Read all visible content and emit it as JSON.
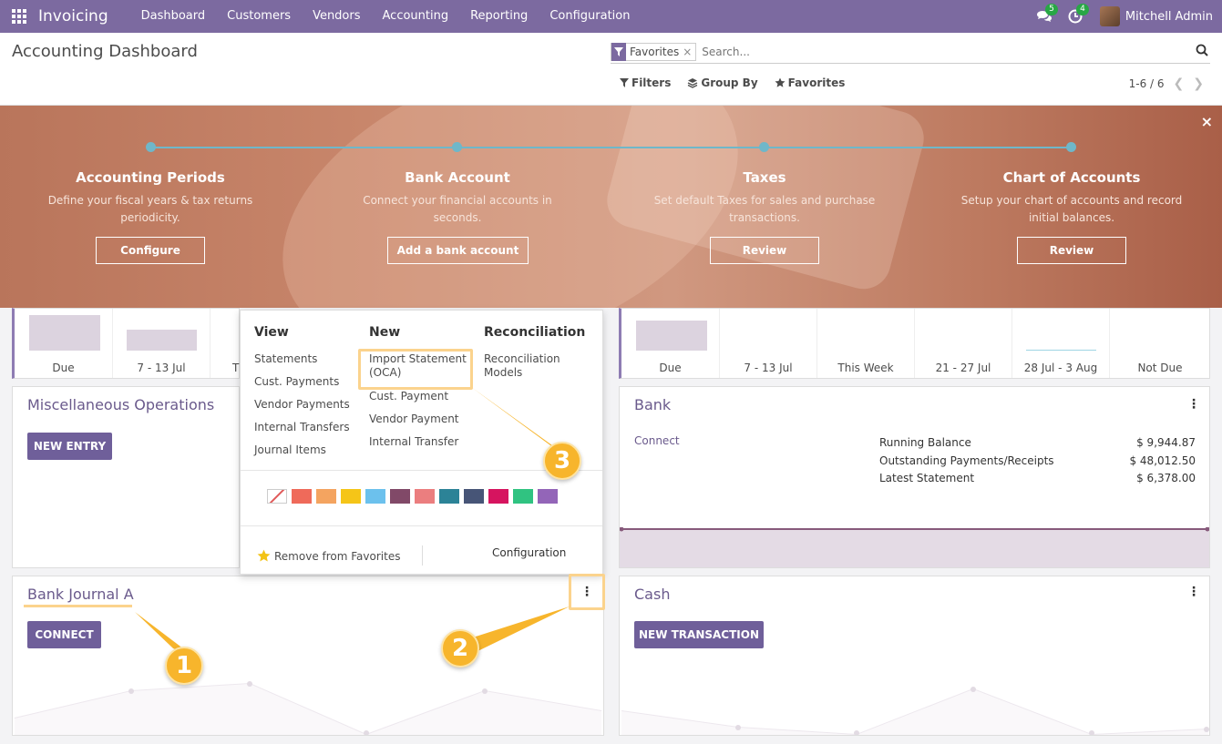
{
  "navbar": {
    "app_name": "Invoicing",
    "menu": [
      "Dashboard",
      "Customers",
      "Vendors",
      "Accounting",
      "Reporting",
      "Configuration"
    ],
    "messages_count": "5",
    "activities_count": "4",
    "user_name": "Mitchell Admin"
  },
  "control_panel": {
    "title": "Accounting Dashboard",
    "facet_label": "Favorites",
    "facet_close": "×",
    "search_placeholder": "Search...",
    "filters_label": "Filters",
    "groupby_label": "Group By",
    "favorites_label": "Favorites",
    "pager": "1-6 / 6"
  },
  "banner": {
    "close": "×",
    "steps": [
      {
        "title": "Accounting Periods",
        "desc": "Define your fiscal years & tax returns periodicity.",
        "button": "Configure"
      },
      {
        "title": "Bank Account",
        "desc": "Connect your financial accounts in seconds.",
        "button": "Add a bank account"
      },
      {
        "title": "Taxes",
        "desc": "Set default Taxes for sales and purchase transactions.",
        "button": "Review"
      },
      {
        "title": "Chart of Accounts",
        "desc": "Setup your chart of accounts and record initial balances.",
        "button": "Review"
      }
    ]
  },
  "left_top_card": {
    "labels": [
      "Due",
      "7 - 13 Jul",
      "T"
    ]
  },
  "right_top_card": {
    "labels": [
      "Due",
      "7 - 13 Jul",
      "This Week",
      "21 - 27 Jul",
      "28 Jul - 3 Aug",
      "Not Due"
    ]
  },
  "misc_card": {
    "title": "Miscellaneous Operations",
    "button": "NEW ENTRY"
  },
  "bank_card": {
    "title": "Bank",
    "connect": "Connect",
    "rows": [
      {
        "label": "Running Balance",
        "value": "$ 9,944.87"
      },
      {
        "label": "Outstanding Payments/Receipts",
        "value": "$ 48,012.50"
      },
      {
        "label": "Latest Statement",
        "value": "$ 6,378.00"
      }
    ]
  },
  "bank_journal_card": {
    "title": "Bank Journal A",
    "button": "CONNECT"
  },
  "cash_card": {
    "title": "Cash",
    "button": "NEW TRANSACTION"
  },
  "dropdown": {
    "view_head": "View",
    "view_items": [
      "Statements",
      "Cust. Payments",
      "Vendor Payments",
      "Internal Transfers",
      "Journal Items"
    ],
    "new_head": "New",
    "new_items": [
      "Import Statement (OCA)",
      "Cust. Payment",
      "Vendor Payment",
      "Internal Transfer"
    ],
    "reco_head": "Reconciliation",
    "reco_items": [
      "Reconciliation Models"
    ],
    "colors": [
      "#ef6a5a",
      "#f4a460",
      "#f5c518",
      "#6cc1ed",
      "#814968",
      "#eb7e7f",
      "#2c8397",
      "#475577",
      "#d6145f",
      "#30c381",
      "#9365b8"
    ],
    "remove_favorites": "Remove from Favorites",
    "configuration": "Configuration"
  },
  "callouts": [
    "1",
    "2",
    "3"
  ]
}
